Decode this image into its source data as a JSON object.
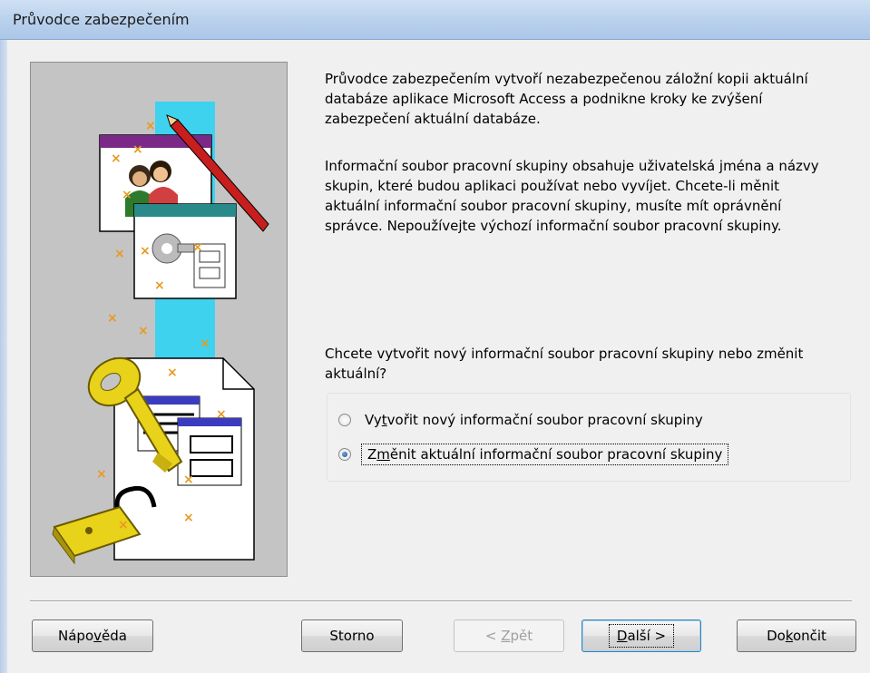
{
  "window": {
    "title": "Průvodce zabezpečením"
  },
  "description": {
    "paragraph1": "Průvodce zabezpečením vytvoří nezabezpečenou záložní kopii aktuální databáze aplikace Microsoft Access a podnikne kroky ke zvýšení zabezpečení aktuální databáze.",
    "paragraph2": "Informační soubor pracovní skupiny obsahuje uživatelská jména a názvy skupin, které budou aplikaci používat nebo vyvíjet. Chcete-li měnit aktuální informační soubor pracovní skupiny, musíte mít oprávnění správce. Nepoužívejte výchozí informační soubor pracovní skupiny."
  },
  "question": "Chcete vytvořit nový informační soubor pracovní skupiny nebo změnit aktuální?",
  "options": [
    {
      "pre": "Vy",
      "key": "t",
      "post": "vořit nový informační soubor pracovní skupiny",
      "selected": false
    },
    {
      "pre": "Z",
      "key": "m",
      "post": "ěnit aktuální informační soubor pracovní skupiny",
      "selected": true
    }
  ],
  "buttons": {
    "help": {
      "pre": "Nápo",
      "key": "v",
      "post": "ěda"
    },
    "cancel": {
      "label": "Storno"
    },
    "back": {
      "pre": "< ",
      "key": "Z",
      "post": "pět",
      "disabled": true
    },
    "next": {
      "pre": "",
      "key": "D",
      "post": "alší >",
      "default": true
    },
    "finish": {
      "pre": "Do",
      "key": "k",
      "post": "ončit"
    }
  },
  "colors": {
    "titlebar": "#bcd3ee",
    "dialog_bg": "#f0f0f0",
    "picture_bg": "#c4c4c4",
    "arrow": "#3fd2ef",
    "key_gold": "#e8d21a",
    "default_button_border": "#3c7fb1"
  }
}
